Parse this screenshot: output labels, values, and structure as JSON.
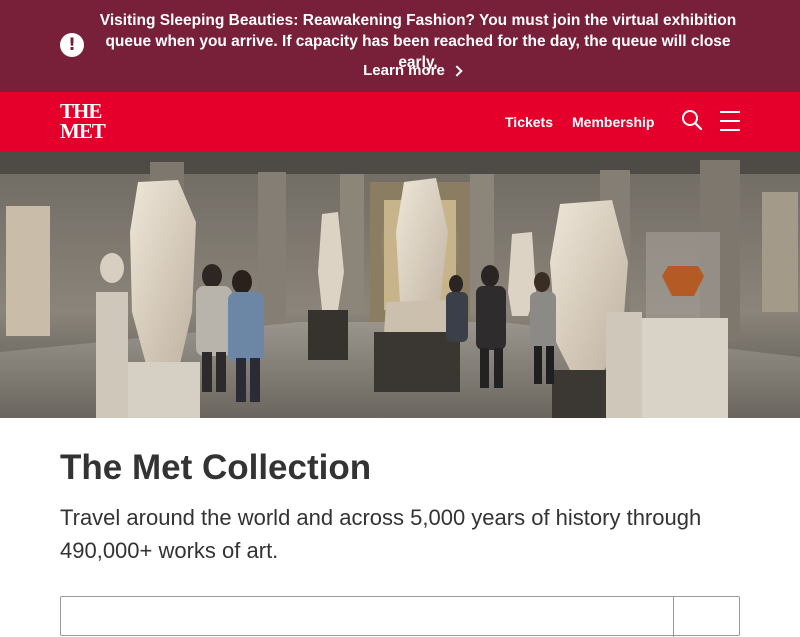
{
  "alert": {
    "message": "Visiting Sleeping Beauties: Reawakening Fashion? You must join the virtual exhibition queue when you arrive. If capacity has been reached for the day, the queue will close early.",
    "link_label": "Learn more",
    "icon": "exclamation-icon",
    "background_color": "#78203a"
  },
  "header": {
    "logo_line1": "THE",
    "logo_line2": "MET",
    "nav": [
      {
        "label": "Tickets"
      },
      {
        "label": "Membership"
      }
    ],
    "search_icon": "search-icon",
    "menu_icon": "hamburger-menu-icon",
    "background_color": "#e4002b"
  },
  "hero": {
    "image": "gallery-with-statues"
  },
  "main": {
    "title": "The Met Collection",
    "subtitle": "Travel around the world and across 5,000 years of history through 490,000+ works of art."
  },
  "search": {
    "placeholder": ""
  }
}
